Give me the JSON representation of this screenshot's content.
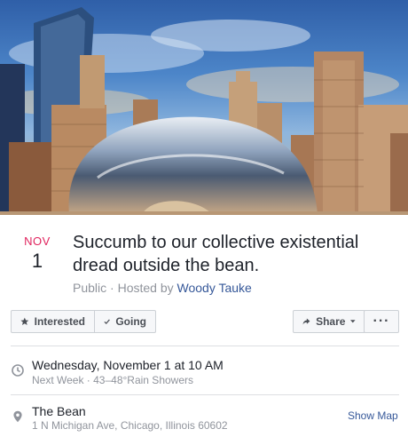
{
  "event": {
    "month": "NOV",
    "day": "1",
    "title": "Succumb to our collective existential dread outside the bean.",
    "visibility": "Public",
    "hosted_by_prefix": "· Hosted by",
    "host_name": "Woody Tauke"
  },
  "actions": {
    "interested_label": "Interested",
    "going_label": "Going",
    "share_label": "Share",
    "more_label": "···"
  },
  "details": {
    "datetime": "Wednesday, November 1 at 10 AM",
    "datetime_sub": "Next Week · 43–48°Rain Showers",
    "location_name": "The Bean",
    "location_address": "1 N Michigan Ave, Chicago, Illinois 60602",
    "show_map_label": "Show Map"
  },
  "colors": {
    "accent_red": "#e0245e",
    "link_blue": "#365899",
    "muted_gray": "#90949c"
  },
  "icons": [
    "star-icon",
    "checkmark-icon",
    "share-arrow-icon",
    "caret-down-icon",
    "clock-icon",
    "location-pin-icon"
  ]
}
